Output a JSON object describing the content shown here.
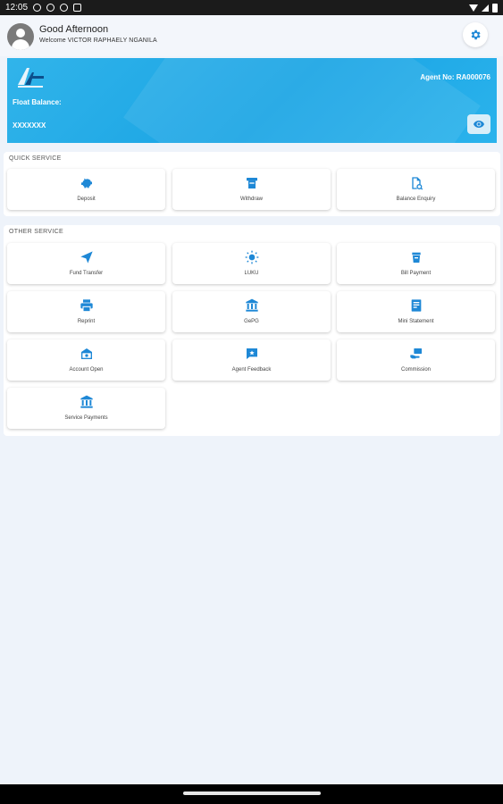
{
  "status_bar": {
    "time": "12:05"
  },
  "header": {
    "greeting": "Good Afternoon",
    "welcome": "Welcome VICTOR RAPHAELY NGANILA"
  },
  "banner": {
    "agent_no": "Agent No: RA000076",
    "float_label": "Float Balance:",
    "float_value": "XXXXXXX"
  },
  "quick_service": {
    "title": "QUICK SERVICE",
    "items": [
      {
        "label": "Deposit",
        "icon": "piggy-bank-icon"
      },
      {
        "label": "Withdraw",
        "icon": "cash-withdraw-icon"
      },
      {
        "label": "Balance Enquiry",
        "icon": "balance-document-icon"
      }
    ]
  },
  "other_service": {
    "title": "OTHER SERVICE",
    "items": [
      {
        "label": "Fund Transfer",
        "icon": "send-icon"
      },
      {
        "label": "LUKU",
        "icon": "sun-icon"
      },
      {
        "label": "Bill Payment",
        "icon": "bill-icon"
      },
      {
        "label": "Reprint",
        "icon": "printer-icon"
      },
      {
        "label": "GePG",
        "icon": "bank-icon"
      },
      {
        "label": "Mini Statement",
        "icon": "statement-icon"
      },
      {
        "label": "Account Open",
        "icon": "account-open-icon"
      },
      {
        "label": "Agent Feedback",
        "icon": "feedback-icon"
      },
      {
        "label": "Commission",
        "icon": "commission-icon"
      },
      {
        "label": "Service Payments",
        "icon": "bank-icon"
      }
    ]
  },
  "colors": {
    "accent": "#1ba6e4",
    "icon": "#1e88d6",
    "background": "#eef3fa"
  }
}
